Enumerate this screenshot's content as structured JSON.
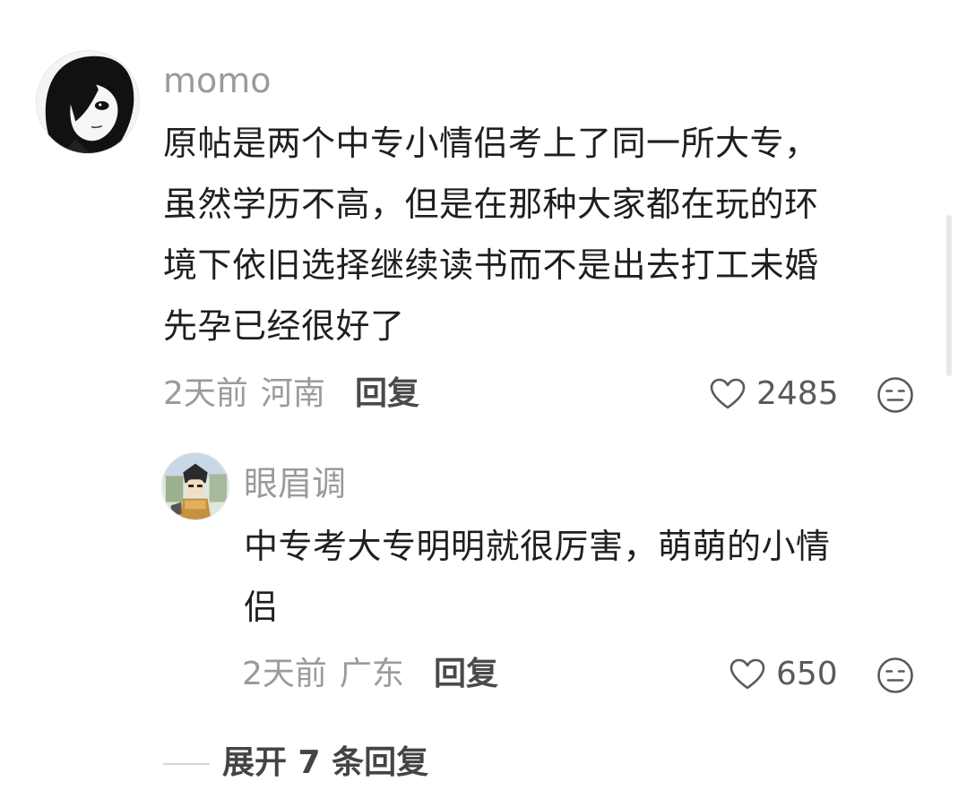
{
  "comment": {
    "username": "momo",
    "text_lines": [
      "原帖是两个中专小情侣考上了同一所大专，",
      "虽然学历不高，但是在那种大家都在玩的环",
      "境下依旧选择继续读书而不是出去打工未婚",
      "先孕已经很好了"
    ],
    "time": "2天前",
    "location": "河南",
    "reply_label": "回复",
    "likes": "2485"
  },
  "reply": {
    "username": "眼眉调",
    "text_lines": [
      "中专考大专明明就很厉害，萌萌的小情",
      "侣"
    ],
    "time": "2天前",
    "location": "广东",
    "reply_label": "回复",
    "likes": "650"
  },
  "expand_label": "展开 7 条回复",
  "icons": {
    "like": "heart-outline-icon",
    "dislike": "neutral-face-icon"
  },
  "colors": {
    "meta_gray": "#9b9b9b",
    "text": "#1f1f1f",
    "icon": "#5a5a5a"
  }
}
